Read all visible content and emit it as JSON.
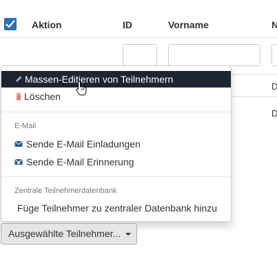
{
  "table": {
    "headers": {
      "aktion": "Aktion",
      "id": "ID",
      "vorname": "Vorname",
      "next_partial": "N"
    },
    "row_partial_values": [
      "D",
      "D"
    ]
  },
  "dropdown": {
    "items": [
      {
        "label": "Massen-Editieren von Teilnehmern",
        "icon": "pencil-icon",
        "active": true
      },
      {
        "label": "Löschen",
        "icon": "trash-icon",
        "active": false
      }
    ],
    "email_section": {
      "header": "E-Mail",
      "items": [
        {
          "label": "Sende E-Mail Einladungen",
          "icon": "envelope-icon"
        },
        {
          "label": "Sende E-Mail Erinnerung",
          "icon": "envelope-reminder-icon"
        }
      ]
    },
    "central_section": {
      "header": "Zentrale Teilnehmerdatenbank",
      "items": [
        {
          "label": "Füge Teilnehmer zu zentraler Datenbank hinzu"
        }
      ]
    }
  },
  "bulk_button": {
    "label": "Ausgewählte Teilnehmer..."
  },
  "colors": {
    "checkbox": "#2b6fb6",
    "active_item_bg": "#1e2430",
    "trash_icon": "#e08080",
    "envelope_icon": "#2a5a8a"
  }
}
